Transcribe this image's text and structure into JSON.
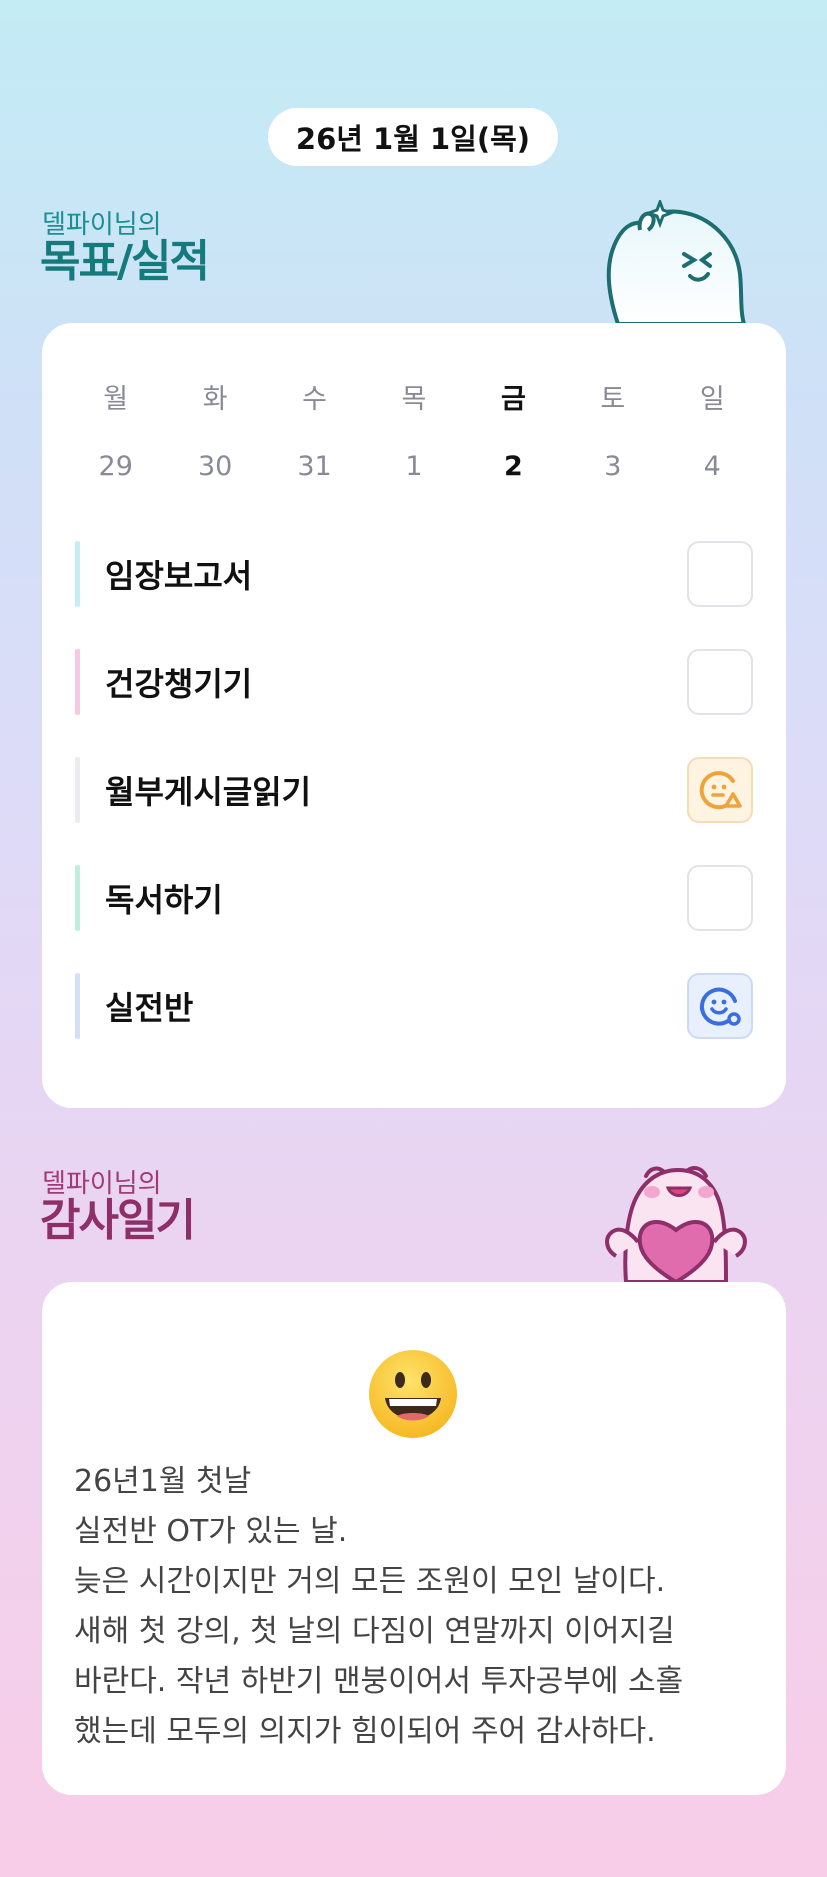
{
  "date": "26년 1월 1일(목)",
  "goals_section": {
    "subtitle": "델파이님의",
    "title": "목표/실적"
  },
  "week": {
    "days": [
      "월",
      "화",
      "수",
      "목",
      "금",
      "토",
      "일"
    ],
    "dates": [
      "29",
      "30",
      "31",
      "1",
      "2",
      "3",
      "4"
    ],
    "active_index": 4
  },
  "goals": [
    {
      "label": "임장보고서",
      "bar_color": "#c6edf3",
      "status": "empty"
    },
    {
      "label": "건강챙기기",
      "bar_color": "#f8c9e2",
      "status": "empty"
    },
    {
      "label": "월부게시글읽기",
      "bar_color": "#ececee",
      "status": "partial-orange-face-icon"
    },
    {
      "label": "독서하기",
      "bar_color": "#bfeedd",
      "status": "empty"
    },
    {
      "label": "실전반",
      "bar_color": "#d3e1f8",
      "status": "done-blue-face-icon"
    }
  ],
  "thanks_section": {
    "subtitle": "델파이님의",
    "title": "감사일기"
  },
  "thanks": {
    "emoji": "grinning-face",
    "text": "26년1월 첫날\n실전반 OT가 있는 날.\n늦은 시간이지만 거의 모든 조원이 모인 날이다.\n새해 첫 강의, 첫 날의 다짐이 연말까지 이어지길\n바란다. 작년 하반기 맨붕이어서 투자공부에 소홀\n했는데 모두의 의지가 힘이되어 주어 감사하다."
  },
  "colors": {
    "goal_title": "#157a7c",
    "thanks_title": "#8e2f69",
    "orange_icon": "#f0a33a",
    "blue_icon": "#3a6ee0"
  }
}
